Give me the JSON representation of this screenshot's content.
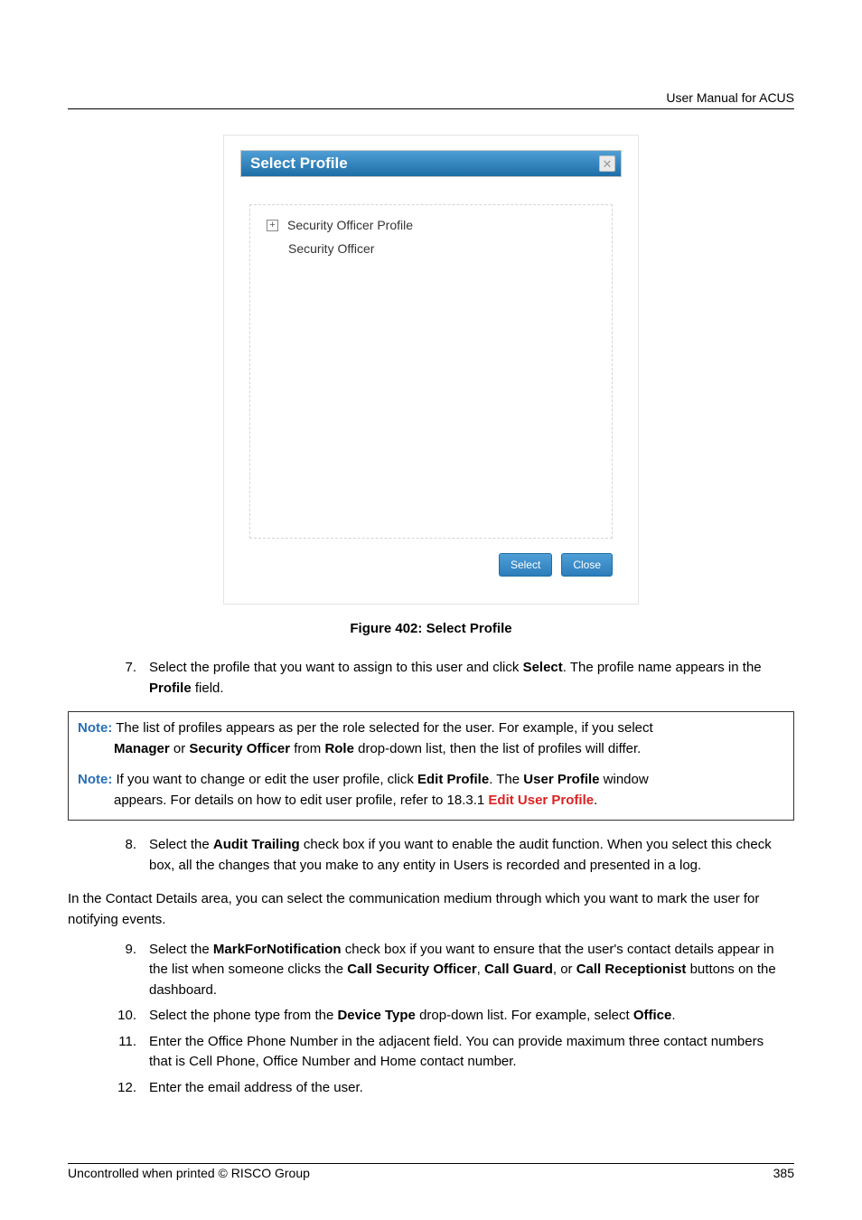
{
  "header": {
    "right": "User Manual for ACUS"
  },
  "dialog": {
    "title": "Select Profile",
    "close_label": "✕",
    "tree": {
      "expander": "+",
      "root": "Security Officer Profile",
      "child": "Security Officer"
    },
    "select_label": "Select",
    "close_btn_label": "Close"
  },
  "figure_caption": "Figure 402: Select Profile",
  "step7": {
    "num": "7.",
    "pre": "Select the profile that you want to assign to this user and click ",
    "b1": "Select",
    "mid": ". The profile name appears in the ",
    "b2": "Profile",
    "post": " field."
  },
  "note_box": {
    "p1": {
      "label": "Note:",
      "l1": " The list of profiles appears as per the role selected for the user. For example, if you select",
      "l2_pre": "",
      "b1": "Manager",
      "l2_mid1": " or ",
      "b2": "Security Officer",
      "l2_mid2": " from ",
      "b3": "Role",
      "l2_post": " drop-down list, then the list of profiles will differ."
    },
    "p2": {
      "label": "Note:",
      "l1_pre": " If you want to change or edit the user profile, click ",
      "b1": "Edit Profile",
      "l1_mid": ". The ",
      "b2": "User Profile",
      "l1_post": " window",
      "l2_pre": "appears. For details on how to edit user profile, refer to 18.3.1 ",
      "link": "Edit User Profile",
      "l2_post": "."
    }
  },
  "step8": {
    "num": "8.",
    "pre": "Select the ",
    "b1": "Audit Trailing",
    "post": " check box if you want to enable the audit function. When you select this check box, all the changes that you make to any entity in Users is recorded and presented in a log."
  },
  "para_contact": "In the Contact Details area, you can select the communication medium through which you want to mark the user for notifying events.",
  "step9": {
    "num": "9.",
    "pre": "Select the ",
    "b1": "MarkForNotification",
    "mid1": " check box if you want to ensure that the user's contact details appear in the list when someone clicks the ",
    "b2": "Call Security Officer",
    "mid2": ", ",
    "b3": "Call Guard",
    "mid3": ", or ",
    "b4": "Call Receptionist",
    "post": " buttons on the dashboard."
  },
  "step10": {
    "num": "10.",
    "pre": "Select the phone type from the ",
    "b1": "Device Type",
    "mid": " drop-down list. For example, select ",
    "b2": "Office",
    "post": "."
  },
  "step11": {
    "num": "11.",
    "text": "Enter the Office Phone Number in the adjacent field. You can provide maximum three contact numbers that is Cell Phone, Office Number and Home contact number."
  },
  "step12": {
    "num": "12.",
    "text": "Enter the email address of the user."
  },
  "footer": {
    "left": "Uncontrolled when printed © RISCO Group",
    "right": "385"
  }
}
